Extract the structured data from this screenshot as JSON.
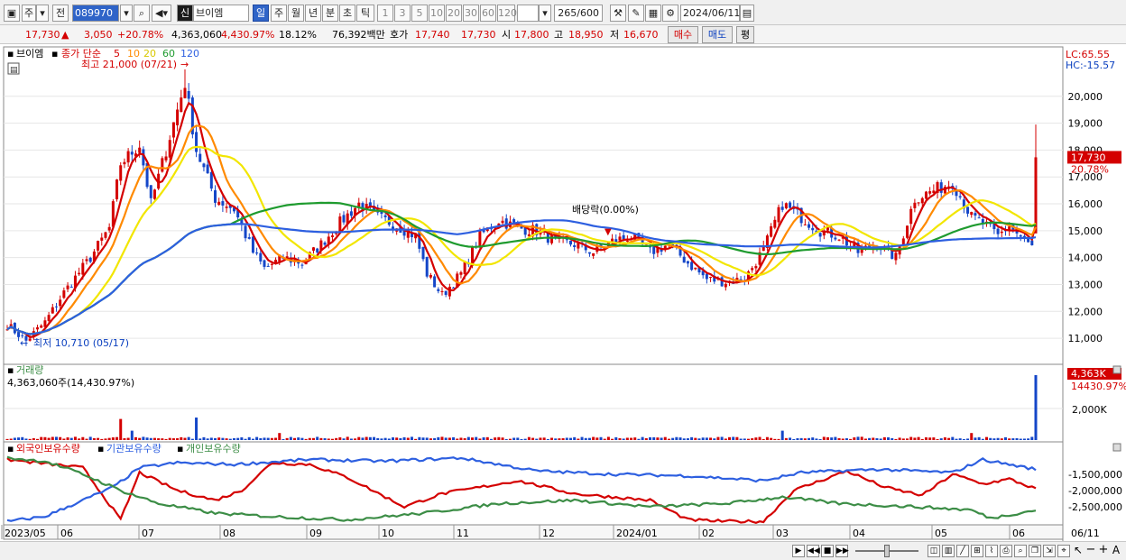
{
  "toolbar": {
    "market_label": "주",
    "prev_label": "전",
    "stock_code": "089970",
    "stock_badge": "신",
    "stock_name": "브이엠",
    "periods": [
      "일",
      "주",
      "월",
      "년",
      "분",
      "초",
      "틱"
    ],
    "active_period": "일",
    "intervals": [
      "1",
      "3",
      "5",
      "10",
      "20",
      "30",
      "60",
      "120"
    ],
    "count_label": "265/600",
    "date": "2024/06/11"
  },
  "quote": {
    "price": "17,730",
    "change": "3,050",
    "change_pct": "+20.78%",
    "volume": "4,363,060",
    "volume_pct": "4,430.97%",
    "turnover": "18.12%",
    "amount": "76,392백만",
    "bid_label": "호가",
    "bid1": "17,740",
    "bid2": "17,730",
    "open_label": "시",
    "open": "17,800",
    "high_label": "고",
    "high": "18,950",
    "low_label": "저",
    "low": "16,670",
    "buy_label": "매수",
    "sell_label": "매도",
    "avg_label": "평"
  },
  "chart_data": [
    {
      "type": "candlestick",
      "panel": "price",
      "legend": {
        "stock": "브이엠",
        "ma_title": "종가 단순",
        "ma_periods": [
          "5",
          "10",
          "20",
          "60",
          "120"
        ],
        "ma_colors": [
          "#d40000",
          "#ff8a00",
          "#f2e600",
          "#1f9b2f",
          "#2d5fe0"
        ]
      },
      "y_ticks": [
        "20,000",
        "19,000",
        "18,000",
        "17,000",
        "16,000",
        "15,000",
        "14,000",
        "13,000",
        "12,000",
        "11,000"
      ],
      "ylim": [
        10500,
        21300
      ],
      "lc_label": "LC:65.55",
      "hc_label": "HC:-15.57",
      "current_price_tag": "17,730",
      "current_pct_tag": "20.78%",
      "annotations": {
        "high": "최고 21,000 (07/21)",
        "low": "최저 10,710 (05/17)",
        "dividend": "배당락(0.00%)"
      },
      "x_labels": [
        "2023/05",
        "06",
        "07",
        "08",
        "09",
        "10",
        "11",
        "12",
        "2024/01",
        "02",
        "03",
        "04",
        "05",
        "06",
        "06/11"
      ],
      "anchors": [
        [
          0,
          11500
        ],
        [
          5,
          10900
        ],
        [
          10,
          11600
        ],
        [
          15,
          12700
        ],
        [
          22,
          14000
        ],
        [
          27,
          15100
        ],
        [
          30,
          17500
        ],
        [
          35,
          18200
        ],
        [
          38,
          16000
        ],
        [
          43,
          18500
        ],
        [
          47,
          20500
        ],
        [
          50,
          18000
        ],
        [
          55,
          16200
        ],
        [
          60,
          15800
        ],
        [
          65,
          14200
        ],
        [
          68,
          13600
        ],
        [
          73,
          14000
        ],
        [
          78,
          13800
        ],
        [
          83,
          14500
        ],
        [
          88,
          15300
        ],
        [
          93,
          16000
        ],
        [
          98,
          15500
        ],
        [
          103,
          15200
        ],
        [
          108,
          14800
        ],
        [
          111,
          13400
        ],
        [
          115,
          12600
        ],
        [
          120,
          13400
        ],
        [
          125,
          14800
        ],
        [
          130,
          15400
        ],
        [
          135,
          15100
        ],
        [
          140,
          15000
        ],
        [
          145,
          14600
        ],
        [
          150,
          14500
        ],
        [
          155,
          14200
        ],
        [
          160,
          14600
        ],
        [
          165,
          14800
        ],
        [
          170,
          14200
        ],
        [
          175,
          14500
        ],
        [
          180,
          13800
        ],
        [
          185,
          13200
        ],
        [
          190,
          13100
        ],
        [
          195,
          13200
        ],
        [
          200,
          14300
        ],
        [
          205,
          16000
        ],
        [
          210,
          15500
        ],
        [
          215,
          15000
        ],
        [
          220,
          14800
        ],
        [
          225,
          14200
        ],
        [
          230,
          14500
        ],
        [
          235,
          14000
        ],
        [
          240,
          16200
        ],
        [
          245,
          16500
        ],
        [
          250,
          16800
        ],
        [
          255,
          15500
        ],
        [
          258,
          15300
        ],
        [
          262,
          14800
        ],
        [
          265,
          15200
        ],
        [
          269,
          14600
        ],
        [
          271,
          14400
        ],
        [
          272,
          17730
        ]
      ]
    },
    {
      "type": "bar",
      "panel": "volume",
      "title": "거래량",
      "value_label": "4,363,060주(14,430.97%)",
      "y_ticks": [
        "2,000K"
      ],
      "tag_value": "4,363K",
      "tag_pct": "14430.97%",
      "spikes": [
        [
          30,
          0.45
        ],
        [
          50,
          0.48
        ],
        [
          33,
          0.2
        ],
        [
          72,
          0.15
        ],
        [
          205,
          0.2
        ],
        [
          255,
          0.15
        ],
        [
          272,
          1.0
        ]
      ]
    },
    {
      "type": "line",
      "panel": "holdings",
      "series": [
        {
          "name": "외국인보유수량",
          "color": "#d40000",
          "anchors": [
            [
              0,
              -1050000
            ],
            [
              20,
              -1300000
            ],
            [
              30,
              -2900000
            ],
            [
              35,
              -1450000
            ],
            [
              45,
              -2000000
            ],
            [
              55,
              -2300000
            ],
            [
              62,
              -2000000
            ],
            [
              70,
              -1150000
            ],
            [
              80,
              -1200000
            ],
            [
              90,
              -1600000
            ],
            [
              105,
              -2500000
            ],
            [
              115,
              -2100000
            ],
            [
              125,
              -1900000
            ],
            [
              135,
              -1700000
            ],
            [
              150,
              -2100000
            ],
            [
              160,
              -2200000
            ],
            [
              170,
              -2300000
            ],
            [
              180,
              -2900000
            ],
            [
              190,
              -2950000
            ],
            [
              200,
              -2950000
            ],
            [
              208,
              -2000000
            ],
            [
              215,
              -1700000
            ],
            [
              222,
              -1400000
            ],
            [
              232,
              -1900000
            ],
            [
              242,
              -2150000
            ],
            [
              250,
              -1500000
            ],
            [
              258,
              -1800000
            ],
            [
              265,
              -1650000
            ],
            [
              272,
              -1950000
            ]
          ]
        },
        {
          "name": "기관보유수량",
          "color": "#2d5fe0",
          "anchors": [
            [
              0,
              -2950000
            ],
            [
              10,
              -2800000
            ],
            [
              20,
              -2300000
            ],
            [
              28,
              -1900000
            ],
            [
              35,
              -1300000
            ],
            [
              45,
              -1150000
            ],
            [
              60,
              -1200000
            ],
            [
              80,
              -1050000
            ],
            [
              100,
              -1100000
            ],
            [
              120,
              -1000000
            ],
            [
              140,
              -1400000
            ],
            [
              160,
              -1500000
            ],
            [
              180,
              -1550000
            ],
            [
              200,
              -1700000
            ],
            [
              210,
              -1450000
            ],
            [
              230,
              -1350000
            ],
            [
              250,
              -1450000
            ],
            [
              258,
              -1050000
            ],
            [
              272,
              -1350000
            ]
          ]
        },
        {
          "name": "개인보유수량",
          "color": "#3c8d46",
          "anchors": [
            [
              0,
              -1000000
            ],
            [
              10,
              -1100000
            ],
            [
              20,
              -1500000
            ],
            [
              30,
              -2000000
            ],
            [
              40,
              -2400000
            ],
            [
              55,
              -2700000
            ],
            [
              70,
              -2800000
            ],
            [
              90,
              -2900000
            ],
            [
              110,
              -2700000
            ],
            [
              130,
              -2400000
            ],
            [
              150,
              -2300000
            ],
            [
              170,
              -2500000
            ],
            [
              190,
              -2400000
            ],
            [
              205,
              -2200000
            ],
            [
              220,
              -2400000
            ],
            [
              240,
              -2500000
            ],
            [
              255,
              -2600000
            ],
            [
              260,
              -2850000
            ],
            [
              272,
              -2600000
            ]
          ]
        }
      ],
      "y_ticks": [
        "-1,500,000",
        "-2,000,000",
        "-2,500,000"
      ],
      "ylim": [
        -3000000,
        -950000
      ]
    }
  ]
}
